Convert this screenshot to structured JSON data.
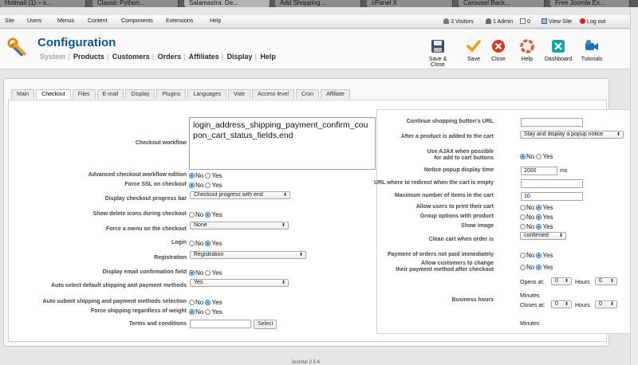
{
  "browser_tabs": [
    "Hotmail (1) – s...",
    "Classic Python...",
    "Salamastra: De...",
    "Add Shopping ...",
    "cPanel X",
    "Carousel Back...",
    "Free Joomla Ex..."
  ],
  "menubar": {
    "items": [
      "Site",
      "Users",
      "Menus",
      "Content",
      "Components",
      "Extensions",
      "Help"
    ],
    "visitors": "3 Visitors",
    "admin": "1 Admin",
    "messages": "0",
    "view_site": "View Site",
    "logout": "Log out"
  },
  "header": {
    "title": "Configuration",
    "subnav": [
      "System",
      "Products",
      "Customers",
      "Orders",
      "Affiliates",
      "Display",
      "Help"
    ],
    "toolbar": [
      "Save & Close",
      "Save",
      "Close",
      "Help",
      "Dashboard",
      "Tutorials"
    ]
  },
  "tabs": [
    "Main",
    "Checkout",
    "Files",
    "E-mail",
    "Display",
    "Plugins",
    "Languages",
    "Vote",
    "Access level",
    "Cron",
    "Affiliate"
  ],
  "left": {
    "checkout_workflow_label": "Checkout workflow",
    "checkout_workflow_value": "login_address_shipping_payment_confirm_coupon_cart_status_fields,end",
    "advanced_label": "Advanced checkout workflow edition",
    "force_ssl_label": "Force SSL on checkout",
    "progress_bar_label": "Display checkout progress bar",
    "progress_bar_value": "Checkout progress with end",
    "delete_icons_label": "Show delete icons during checkout",
    "force_menu_label": "Force a menu on the checkout",
    "force_menu_value": "None",
    "login_label": "Login",
    "registration_label": "Registration",
    "registration_value": "Registration",
    "email_confirm_label": "Display email confirmation field",
    "auto_select_label": "Auto select default shipping and payment methods",
    "auto_select_value": "Yes",
    "auto_submit_label": "Auto submit shipping and payment methods selection",
    "force_shipping_label": "Force shipping regardless of weight",
    "terms_label": "Terms and conditions",
    "terms_button": "Select",
    "no": "No",
    "yes": "Yes"
  },
  "right": {
    "continue_url_label": "Continue shopping button's URL",
    "after_add_label": "After a product is added to the cart",
    "after_add_value": "Stay and display a popup notice",
    "ajax_label_1": "Use AJAX when possible",
    "ajax_label_2": "for add to cart buttons",
    "popup_time_label": "Notice popup display time",
    "popup_time_value": "2000",
    "popup_time_unit": "ms",
    "redirect_url_label": "URL where to redirect when the cart is empty",
    "max_items_label": "Maximum number of items in the cart",
    "max_items_value": "10",
    "print_cart_label": "Allow users to print their cart",
    "group_options_label": "Group options with product",
    "show_image_label": "Show image",
    "clean_cart_label": "Clean cart when order is",
    "clean_cart_value": "confirmed",
    "unpaid_label": "Payment of orders not paid immediately",
    "change_payment_label_1": "Allow customers to change",
    "change_payment_label_2": "their payment method after checkout",
    "business_hours_label": "Business hours",
    "opens_at": "Opens at:",
    "closes_at": "Closes at:",
    "hours": "Hours",
    "minutes": "Minutes",
    "zero": "0"
  },
  "footer": "Joomla! 2.5.4"
}
